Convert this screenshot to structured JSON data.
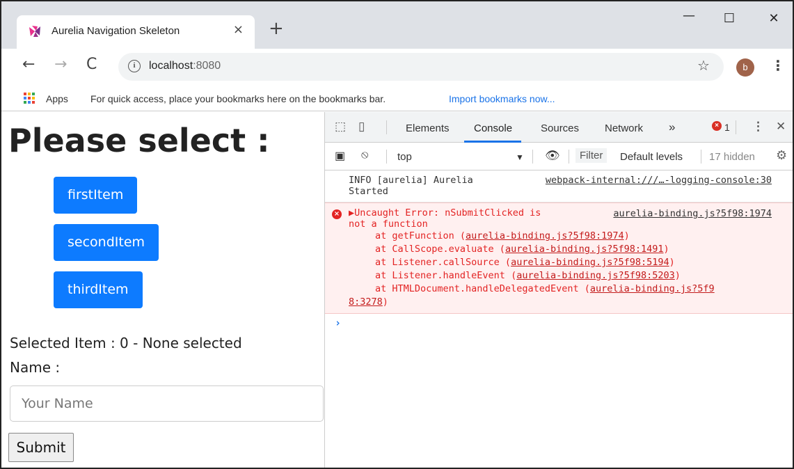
{
  "browser": {
    "tab_title": "Aurelia Navigation Skeleton",
    "tab_close": "×",
    "new_tab": "+",
    "url_host": "localhost",
    "url_port": ":8080",
    "avatar_letter": "b",
    "window_min": "—",
    "window_max": "☐",
    "window_close": "✕"
  },
  "bookmarks": {
    "apps_label": "Apps",
    "hint_text": "For quick access, place your bookmarks here on the bookmarks bar.",
    "import_link": "Import bookmarks now..."
  },
  "page": {
    "heading": "Please select :",
    "items": [
      {
        "label": "firstItem"
      },
      {
        "label": "secondItem"
      },
      {
        "label": "thirdItem"
      }
    ],
    "status": "Selected Item : 0 - None selected",
    "name_label": "Name :",
    "name_placeholder": "Your Name",
    "submit_label": "Submit"
  },
  "devtools": {
    "tabs": [
      "Elements",
      "Console",
      "Sources",
      "Network"
    ],
    "active_tab": "Console",
    "more": "»",
    "error_count": "1",
    "context": "top",
    "filter_label": "Filter",
    "levels": "Default levels",
    "hidden": "17 hidden",
    "messages": {
      "info_text_1": "INFO [aurelia] Aurelia",
      "info_text_2": "Started",
      "info_source": "webpack-internal:///…-logging-console:30",
      "error_text_1": "▶Uncaught Error: nSubmitClicked is",
      "error_text_2": "not a function",
      "error_source": "aurelia-binding.js?5f98:1974",
      "stack": [
        {
          "at": "at getFunction (",
          "link": "aurelia-binding.js?5f98:1974",
          "end": ")"
        },
        {
          "at": "at CallScope.evaluate (",
          "link": "aurelia-binding.js?5f98:1491",
          "end": ")"
        },
        {
          "at": "at Listener.callSource (",
          "link": "aurelia-binding.js?5f98:5194",
          "end": ")"
        },
        {
          "at": "at Listener.handleEvent (",
          "link": "aurelia-binding.js?5f98:5203",
          "end": ")"
        },
        {
          "at": "at HTMLDocument.handleDelegatedEvent (",
          "link": "aurelia-binding.js?5f9",
          "end": ""
        }
      ],
      "stack_tail_link": "8:3278",
      "stack_tail_end": ")"
    },
    "prompt": "›"
  },
  "colors": {
    "primary_button": "#0d7bff",
    "error_red": "#e32323",
    "link_blue": "#1a73e8"
  }
}
